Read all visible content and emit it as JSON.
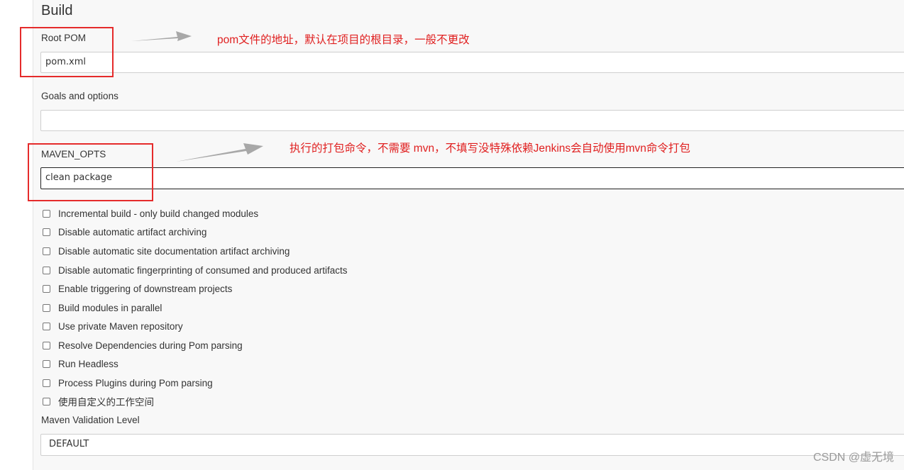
{
  "section": {
    "title": "Build"
  },
  "root_pom": {
    "label": "Root POM",
    "value": "pom.xml"
  },
  "goals": {
    "label": "Goals and options",
    "value": ""
  },
  "maven_opts": {
    "label": "MAVEN_OPTS",
    "value": "clean package"
  },
  "checkboxes": [
    {
      "label": "Incremental build - only build changed modules",
      "checked": false
    },
    {
      "label": "Disable automatic artifact archiving",
      "checked": false
    },
    {
      "label": "Disable automatic site documentation artifact archiving",
      "checked": false
    },
    {
      "label": "Disable automatic fingerprinting of consumed and produced artifacts",
      "checked": false
    },
    {
      "label": "Enable triggering of downstream projects",
      "checked": false
    },
    {
      "label": "Build modules in parallel",
      "checked": false
    },
    {
      "label": "Use private Maven repository",
      "checked": false
    },
    {
      "label": "Resolve Dependencies during Pom parsing",
      "checked": false
    },
    {
      "label": "Run Headless",
      "checked": false
    },
    {
      "label": "Process Plugins during Pom parsing",
      "checked": false
    },
    {
      "label": "使用自定义的工作空间",
      "checked": false
    }
  ],
  "validation": {
    "label": "Maven Validation Level",
    "value": "DEFAULT"
  },
  "annotations": {
    "root_pom_note": "pom文件的地址，默认在项目的根目录，一般不更改",
    "maven_opts_note": "执行的打包命令，不需要 mvn，不填写没特殊依赖Jenkins会自动使用mvn命令打包"
  },
  "watermark": "CSDN @虚无境",
  "colors": {
    "annotation": "#e02020",
    "panel": "#f8f8f8",
    "arrow": "#a8a8a8"
  }
}
